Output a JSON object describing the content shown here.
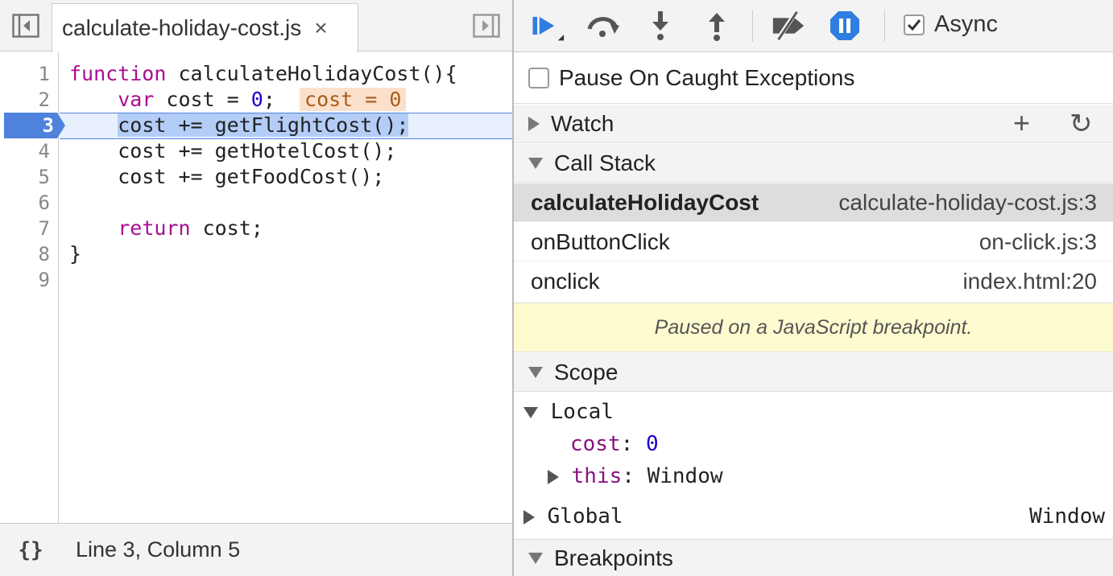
{
  "editor": {
    "file_tab": "calculate-holiday-cost.js",
    "close_glyph": "×",
    "line_numbers": [
      "1",
      "2",
      "3",
      "4",
      "5",
      "6",
      "7",
      "8",
      "9"
    ],
    "code": {
      "l1_kw": "function",
      "l1_rest": " calculateHolidayCost(){",
      "l2_indent": "    ",
      "l2_kw": "var",
      "l2_mid": " cost = ",
      "l2_num": "0",
      "l2_end": ";  ",
      "l2_inline": "cost = 0",
      "l3_indent": "    ",
      "l3_sel": "cost += getFlightCost();",
      "l4": "    cost += getHotelCost();",
      "l5": "    cost += getFoodCost();",
      "l7_indent": "    ",
      "l7_kw": "return",
      "l7_rest": " cost;",
      "l8": "}"
    },
    "current_line": "3",
    "pretty_print": "{}",
    "cursor_position": "Line 3, Column 5"
  },
  "toolbar": {
    "async_label": "Async",
    "async_checked": true
  },
  "pause_on_caught": {
    "label": "Pause On Caught Exceptions",
    "checked": false
  },
  "watch": {
    "title": "Watch",
    "add_glyph": "+",
    "refresh_glyph": "↻"
  },
  "call_stack": {
    "title": "Call Stack",
    "frames": [
      {
        "fn": "calculateHolidayCost",
        "loc": "calculate-holiday-cost.js:3"
      },
      {
        "fn": "onButtonClick",
        "loc": "on-click.js:3"
      },
      {
        "fn": "onclick",
        "loc": "index.html:20"
      }
    ]
  },
  "paused_message": "Paused on a JavaScript breakpoint.",
  "scope": {
    "title": "Scope",
    "local_label": "Local",
    "local_props": [
      {
        "name": "cost",
        "sep": ": ",
        "value": "0"
      },
      {
        "name": "this",
        "sep": ": ",
        "value": "Window"
      }
    ],
    "global_label": "Global",
    "global_value": "Window"
  },
  "breakpoints": {
    "title": "Breakpoints"
  },
  "colors": {
    "accent": "#4e82dd",
    "keyword": "#aa0d91",
    "number": "#1c00cf",
    "paused_bg": "#fffbd0"
  }
}
